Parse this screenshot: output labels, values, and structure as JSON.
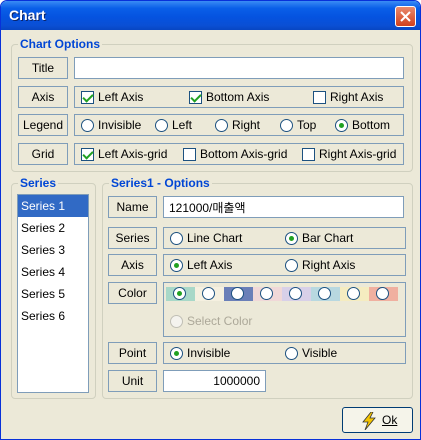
{
  "window": {
    "title": "Chart"
  },
  "chart_options": {
    "legend": "Chart Options",
    "title_label": "Title",
    "title_value": "",
    "axis_label": "Axis",
    "axis": {
      "left": {
        "label": "Left Axis",
        "checked": true
      },
      "bottom": {
        "label": "Bottom Axis",
        "checked": true
      },
      "right": {
        "label": "Right Axis",
        "checked": false
      }
    },
    "legend_label": "Legend",
    "legend_options": {
      "invisible": {
        "label": "Invisible",
        "selected": false
      },
      "left": {
        "label": "Left",
        "selected": false
      },
      "right": {
        "label": "Right",
        "selected": false
      },
      "top": {
        "label": "Top",
        "selected": false
      },
      "bottom": {
        "label": "Bottom",
        "selected": true
      }
    },
    "grid_label": "Grid",
    "grid": {
      "left": {
        "label": "Left Axis-grid",
        "checked": true
      },
      "bottom": {
        "label": "Bottom Axis-grid",
        "checked": false
      },
      "right": {
        "label": "Right Axis-grid",
        "checked": false
      }
    }
  },
  "series_panel": {
    "legend": "Series",
    "items": [
      "Series 1",
      "Series 2",
      "Series 3",
      "Series 4",
      "Series 5",
      "Series 6"
    ],
    "selected_index": 0
  },
  "series_options": {
    "legend": "Series1 - Options",
    "name_label": "Name",
    "name_value": "121000/매출액",
    "series_label": "Series",
    "series_type": {
      "line": {
        "label": "Line Chart",
        "selected": false
      },
      "bar": {
        "label": "Bar Chart",
        "selected": true
      }
    },
    "axis_label": "Axis",
    "axis": {
      "left": {
        "label": "Left Axis",
        "selected": true
      },
      "right": {
        "label": "Right Axis",
        "selected": false
      }
    },
    "color_label": "Color",
    "colors": [
      "#a8d8c8",
      "#f5f0e0",
      "#6a7fb8",
      "#f0d8d8",
      "#d8d0e8",
      "#b8d8e0",
      "#f5ecc0",
      "#f0b0a0"
    ],
    "selected_color_index": 0,
    "select_color_label": "Select Color",
    "point_label": "Point",
    "point": {
      "invisible": {
        "label": "Invisible",
        "selected": true
      },
      "visible": {
        "label": "Visible",
        "selected": false
      }
    },
    "unit_label": "Unit",
    "unit_value": "1000000"
  },
  "ok_button": {
    "label": "Ok",
    "underline": "O"
  }
}
